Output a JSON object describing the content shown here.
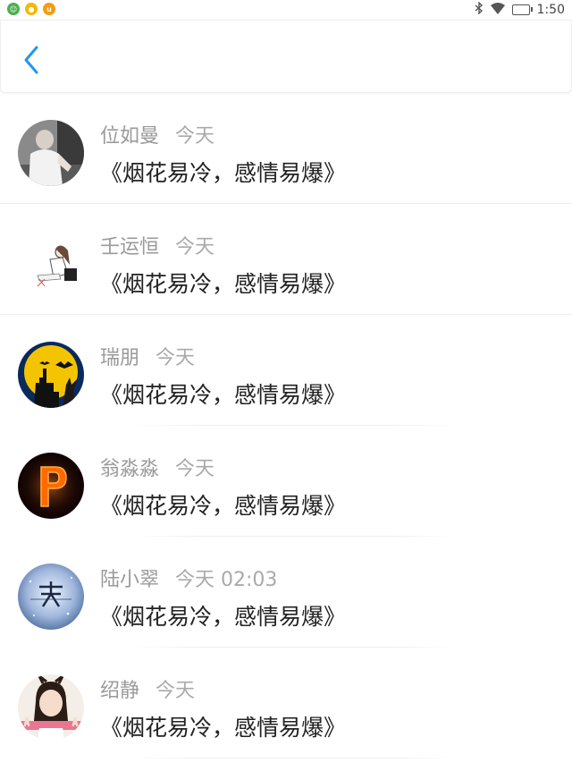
{
  "status_bar": {
    "left_apps": [
      "green-app-icon",
      "yellow-app-icon",
      "orange-u-app-icon"
    ],
    "battery_text": "",
    "time": "1:50"
  },
  "header": {
    "back_icon": "chevron-left-icon",
    "accent_color": "#2196f3"
  },
  "items": [
    {
      "name": "位如曼",
      "time": "今天",
      "message": "《烟花易冷，感情易爆》",
      "avatar": "man-photo-avatar"
    },
    {
      "name": "壬运恒",
      "time": "今天",
      "message": "《烟花易冷，感情易爆》",
      "avatar": "sketch-girl-avatar"
    },
    {
      "name": "瑞朋",
      "time": "今天",
      "message": "《烟花易冷，感情易爆》",
      "avatar": "halloween-moon-avatar"
    },
    {
      "name": "翁淼淼",
      "time": "今天",
      "message": "《烟花易冷，感情易爆》",
      "avatar": "fire-letter-p-avatar"
    },
    {
      "name": "陆小翠",
      "time": "今天 02:03",
      "message": "《烟花易冷，感情易爆》",
      "avatar": "sky-text-avatar"
    },
    {
      "name": "绍静",
      "time": "今天",
      "message": "《烟花易冷，感情易爆》",
      "avatar": "girl-photo-avatar"
    }
  ]
}
